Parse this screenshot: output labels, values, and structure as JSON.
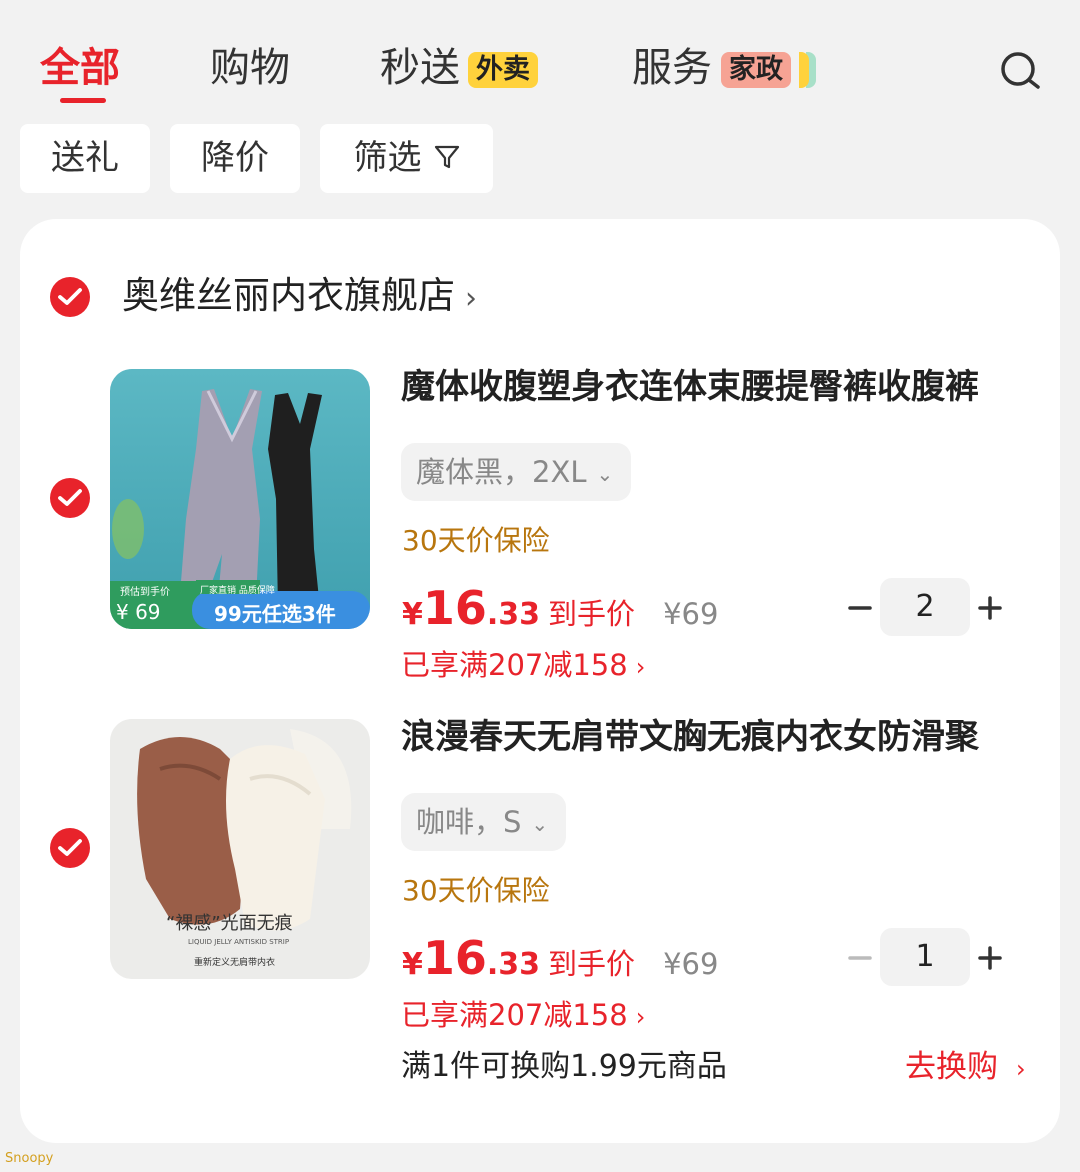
{
  "tabs": [
    {
      "label": "全部",
      "active": true
    },
    {
      "label": "购物",
      "active": false
    },
    {
      "label": "秒送",
      "active": false,
      "badge": "外卖"
    },
    {
      "label": "服务",
      "active": false,
      "badge": "家政"
    }
  ],
  "filters": {
    "gift": "送礼",
    "price_drop": "降价",
    "filter": "筛选"
  },
  "store": {
    "name": "奥维丝丽内衣旗舰店"
  },
  "products": [
    {
      "title": "魔体收腹塑身衣连体束腰提臀裤收腹裤",
      "variant": "魔体黑，2XL",
      "insurance": "30天价保险",
      "price_currency": "¥",
      "price_int": "16",
      "price_dec": ".33",
      "price_tag": "到手价",
      "original_price": "¥69",
      "promo": "已享满207减158",
      "quantity": "2",
      "image_overlay": {
        "top_left": "预估到手价",
        "top_right": "厂家直销 品质保障",
        "price": "¥ 69",
        "offer": "99元任选3件"
      }
    },
    {
      "title": "浪漫春天无肩带文胸无痕内衣女防滑聚",
      "variant": "咖啡，S",
      "insurance": "30天价保险",
      "price_currency": "¥",
      "price_int": "16",
      "price_dec": ".33",
      "price_tag": "到手价",
      "original_price": "¥69",
      "promo": "已享满207减158",
      "quantity": "1",
      "image_overlay": {
        "headline": "“裸感”光面无痕",
        "sub1": "LIQUID JELLY ANTISKID STRIP",
        "sub2": "重新定义无肩带内衣"
      }
    }
  ],
  "exchange": {
    "note": "满1件可换购1.99元商品",
    "link": "去换购"
  },
  "watermark": "Snoopy",
  "colors": {
    "accent": "#e8232b",
    "insurance": "#b8760e",
    "badge_yellow": "#ffd23c",
    "badge_pink": "#f6a394",
    "background": "#f2f2f2"
  }
}
